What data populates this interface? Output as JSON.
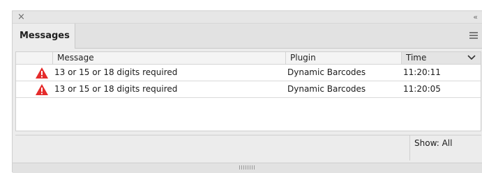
{
  "panel": {
    "tab_label": "Messages",
    "close_glyph": "×",
    "collapse_glyph": "‹‹"
  },
  "table": {
    "columns": {
      "message": "Message",
      "plugin": "Plugin",
      "time": "Time"
    },
    "rows": [
      {
        "icon": "warning-icon",
        "message": "13 or 15 or 18 digits required",
        "plugin": "Dynamic Barcodes",
        "time": "11:20:11"
      },
      {
        "icon": "warning-icon",
        "message": "13 or 15 or 18 digits required",
        "plugin": "Dynamic Barcodes",
        "time": "11:20:05"
      }
    ]
  },
  "footer": {
    "show_filter": "Show: All"
  },
  "colors": {
    "warning": "#e52b2b",
    "panel_bg": "#ececec"
  }
}
